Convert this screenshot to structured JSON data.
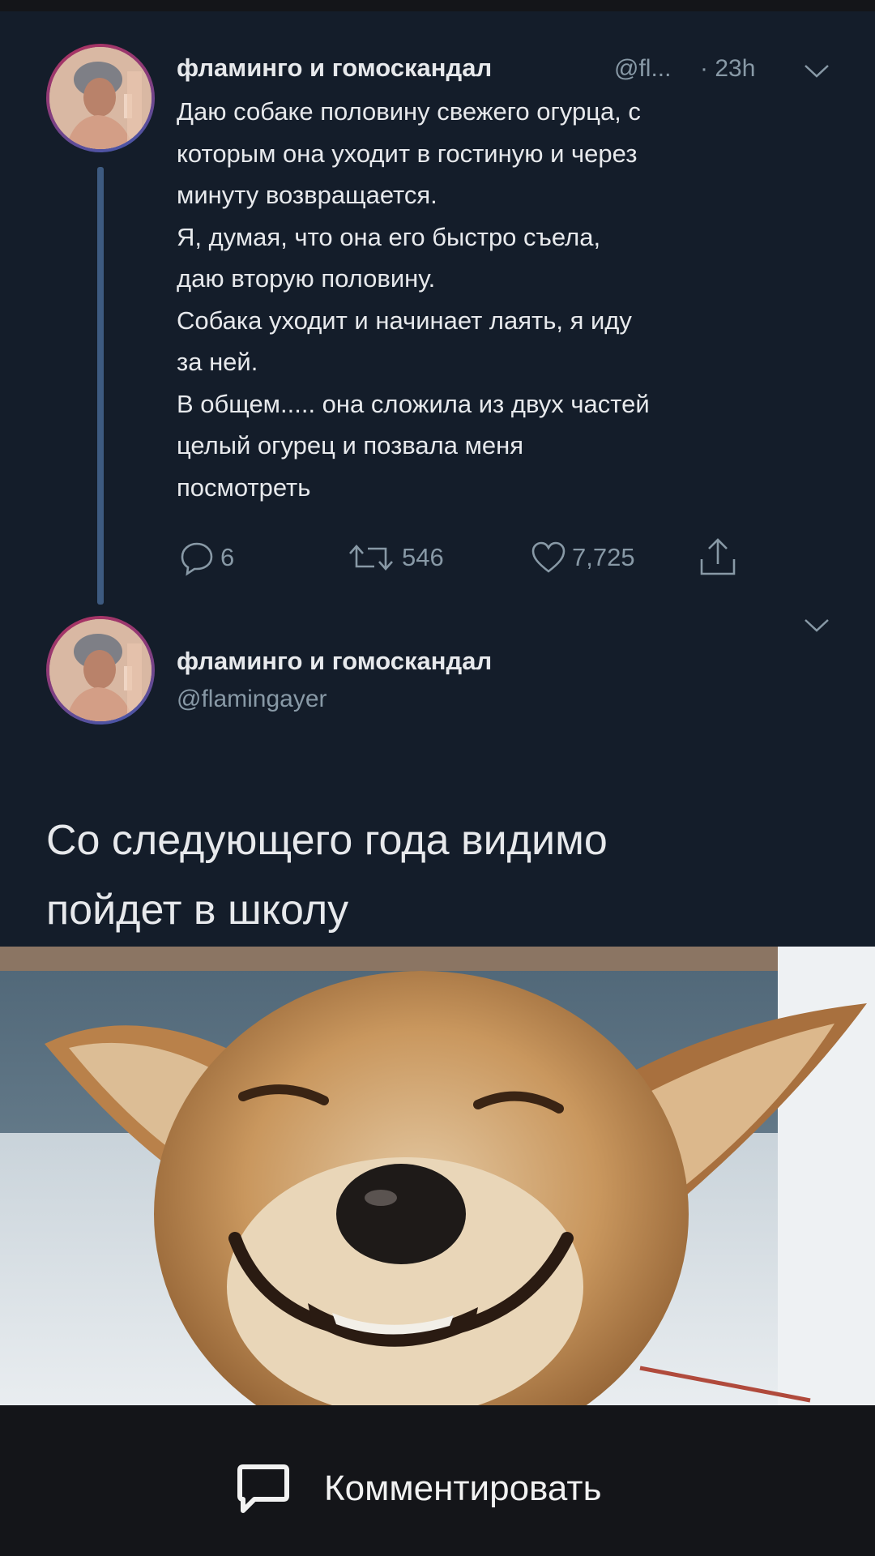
{
  "tweet_1": {
    "author_name": "фламинго и гомоскандал",
    "handle_truncated": "@fl...",
    "time": "· 23h",
    "body_lines": [
      "Даю собаке половину свежего огурца, с",
      "которым она уходит в гостиную и через",
      "минуту возвращается.",
      "Я, думая, что она его быстро съела,",
      "даю вторую половину.",
      "Собака уходит и начинает лаять, я иду",
      "за ней.",
      "В общем..... она сложила из двух частей",
      "целый огурец и позвала меня",
      "посмотреть"
    ],
    "reply_count": "6",
    "retweet_count": "546",
    "like_count": "7,725"
  },
  "tweet_2": {
    "author_name": "фламинго и гомоскандал",
    "handle": "@flamingayer",
    "body_lines": [
      "Со следующего года видимо",
      "пойдет в школу"
    ]
  },
  "bottom_bar": {
    "comment_label": "Комментировать"
  },
  "icons": {
    "reply": "speech-bubble-icon",
    "retweet": "retweet-icon",
    "like": "heart-icon",
    "share": "share-icon",
    "caret": "chevron-down-icon",
    "comment": "comment-icon"
  },
  "colors": {
    "background": "#141519",
    "card": "#141d2a",
    "text_primary": "#e7e9ec",
    "text_secondary": "#8899a6",
    "thread_line": "#3d5a80"
  }
}
